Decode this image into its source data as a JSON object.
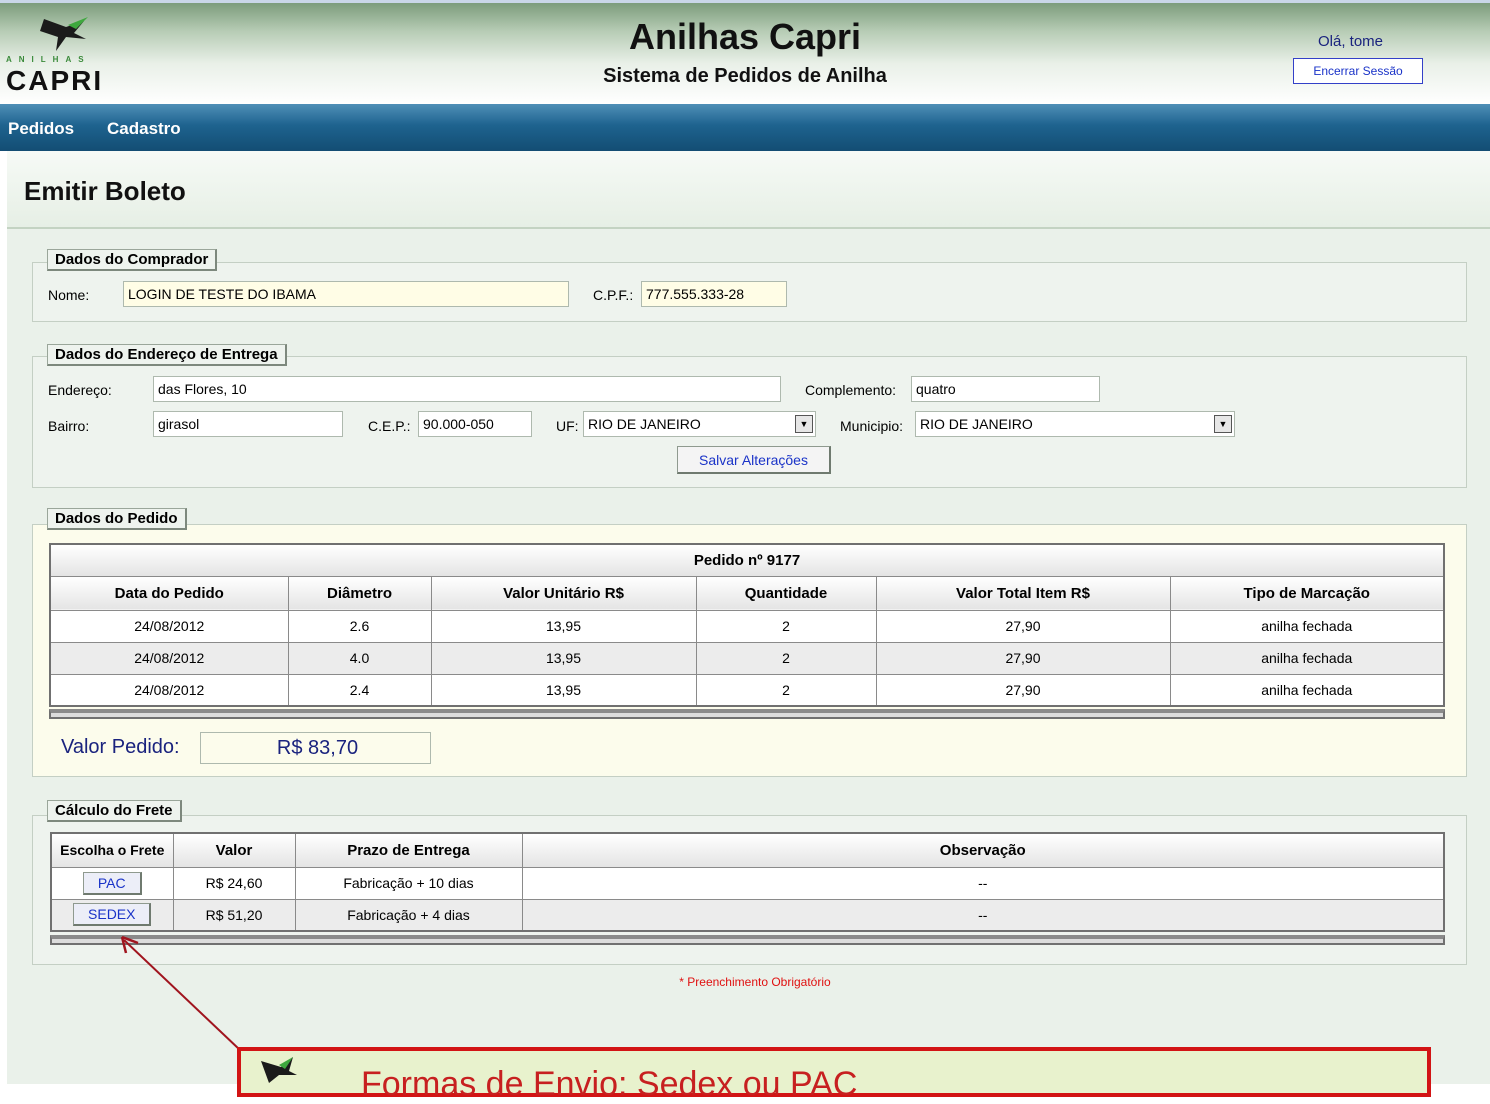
{
  "header": {
    "logo_small": "ANILHAS",
    "logo_big": "CAPRI",
    "title": "Anilhas Capri",
    "subtitle": "Sistema de Pedidos de Anilha",
    "greeting": "Olá, tome",
    "logout_label": "Encerrar Sessão"
  },
  "menu": {
    "items": [
      "Pedidos",
      "Cadastro"
    ]
  },
  "page": {
    "title": "Emitir Boleto",
    "required_note": "* Preenchimento Obrigatório"
  },
  "comprador": {
    "legend": "Dados do Comprador",
    "nome_label": "Nome:",
    "nome_value": "LOGIN DE TESTE DO IBAMA",
    "cpf_label": "C.P.F.:",
    "cpf_value": "777.555.333-28"
  },
  "endereco": {
    "legend": "Dados do Endereço de Entrega",
    "endereco_label": "Endereço:",
    "endereco_value": "das Flores, 10",
    "complemento_label": "Complemento:",
    "complemento_value": "quatro",
    "bairro_label": "Bairro:",
    "bairro_value": "girasol",
    "cep_label": "C.E.P.:",
    "cep_value": "90.000-050",
    "uf_label": "UF:",
    "uf_value": "RIO DE JANEIRO",
    "municipio_label": "Municipio:",
    "municipio_value": "RIO DE JANEIRO",
    "save_label": "Salvar Alterações"
  },
  "pedido": {
    "legend": "Dados do Pedido",
    "caption": "Pedido nº 9177",
    "columns": [
      "Data do Pedido",
      "Diâmetro",
      "Valor Unitário R$",
      "Quantidade",
      "Valor Total Item R$",
      "Tipo de Marcação"
    ],
    "rows": [
      [
        "24/08/2012",
        "2.6",
        "13,95",
        "2",
        "27,90",
        "anilha fechada"
      ],
      [
        "24/08/2012",
        "4.0",
        "13,95",
        "2",
        "27,90",
        "anilha fechada"
      ],
      [
        "24/08/2012",
        "2.4",
        "13,95",
        "2",
        "27,90",
        "anilha fechada"
      ]
    ],
    "total_label": "Valor Pedido:",
    "total_value": "R$ 83,70"
  },
  "frete": {
    "legend": "Cálculo do Frete",
    "columns": [
      "Escolha o Frete",
      "Valor",
      "Prazo de Entrega",
      "Observação"
    ],
    "rows": [
      [
        "PAC",
        "R$ 24,60",
        "Fabricação + 10 dias",
        "--"
      ],
      [
        "SEDEX",
        "R$ 51,20",
        "Fabricação + 4 dias",
        "--"
      ]
    ]
  },
  "callout": {
    "text": "Formas de Envio: Sedex ou PAC"
  },
  "colors": {
    "menu": "#1e638f",
    "accent_red": "#d21414",
    "link": "#1a33c8"
  }
}
